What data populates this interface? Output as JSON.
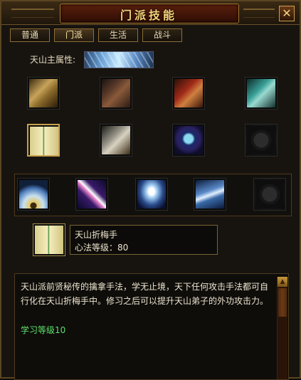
{
  "window": {
    "title": "门派技能",
    "close_label": "✕"
  },
  "tabs": [
    {
      "label": "普通",
      "active": false
    },
    {
      "label": "门派",
      "active": true
    },
    {
      "label": "生活",
      "active": false
    },
    {
      "label": "战斗",
      "active": false
    }
  ],
  "attribute": {
    "label": "天山主属性:",
    "icon": "ice-crystal-icon"
  },
  "skill_rows": [
    [
      "scroll-bundle-icon",
      "dark-tome-icon",
      "red-tome-icon",
      "teal-tome-icon"
    ],
    [
      "open-manual-icon",
      "grey-tome-icon",
      "skull-scroll-icon",
      "empty-slot-icon"
    ],
    [
      "fan-icon",
      "pink-sword-icon",
      "ghost-figure-icon",
      "white-hand-icon",
      "empty-slot-icon"
    ]
  ],
  "selected_skill": {
    "icon": "open-manual-icon",
    "name": "天山折梅手",
    "level_text": "心法等级：80"
  },
  "description": {
    "text": "天山派前贤秘传的擒拿手法，学无止境，天下任何攻击手法都可自行化在天山折梅手中。修习之后可以提升天山弟子的外功攻击力。",
    "learn_level": "学习等级10"
  },
  "colors": {
    "learn_level": "#5ee06a",
    "title": "#f2d27a"
  }
}
